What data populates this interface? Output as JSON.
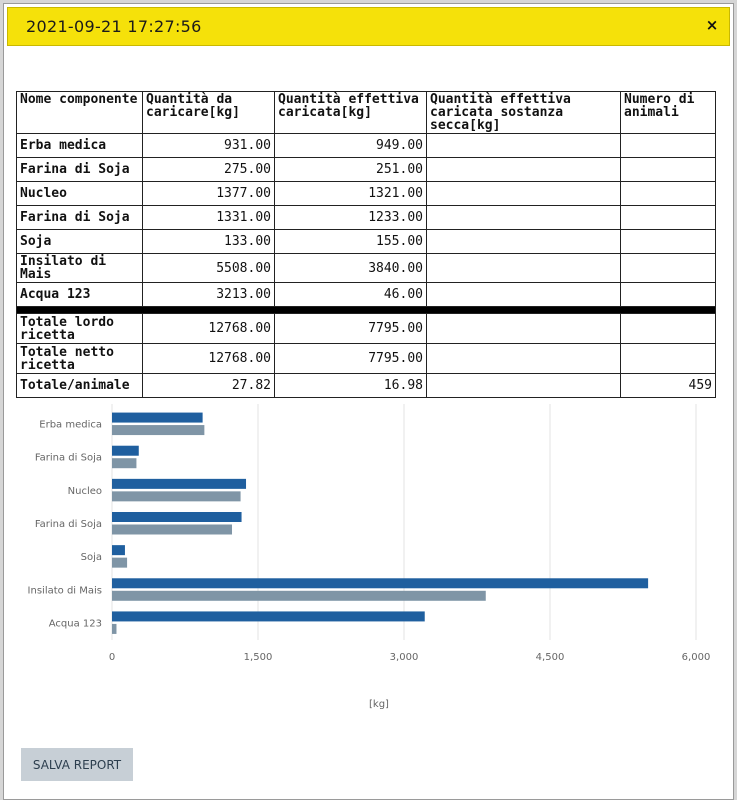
{
  "title": "2021-09-21 17:27:56",
  "close_symbol": "×",
  "table": {
    "headers": [
      "Nome componente",
      "Quantità da caricare[kg]",
      "Quantità effettiva caricata[kg]",
      "Quantità effettiva caricata sostanza secca[kg]",
      "Numero di animali"
    ],
    "rows": [
      [
        "Erba medica",
        "931.00",
        "949.00",
        "",
        ""
      ],
      [
        "Farina di Soja",
        "275.00",
        "251.00",
        "",
        ""
      ],
      [
        "Nucleo",
        "1377.00",
        "1321.00",
        "",
        ""
      ],
      [
        "Farina di Soja",
        "1331.00",
        "1233.00",
        "",
        ""
      ],
      [
        "Soja",
        "133.00",
        "155.00",
        "",
        ""
      ],
      [
        "Insilato di Mais",
        "5508.00",
        "3840.00",
        "",
        ""
      ],
      [
        "Acqua 123",
        "3213.00",
        "46.00",
        "",
        ""
      ]
    ],
    "totals": [
      [
        "Totale lordo ricetta",
        "12768.00",
        "7795.00",
        "",
        ""
      ],
      [
        "Totale netto ricetta",
        "12768.00",
        "7795.00",
        "",
        ""
      ],
      [
        "Totale/animale",
        "27.82",
        "16.98",
        "",
        "459"
      ]
    ]
  },
  "chart_data": {
    "type": "bar",
    "orientation": "horizontal",
    "categories": [
      "Erba medica",
      "Farina di Soja",
      "Nucleo",
      "Farina di Soja",
      "Soja",
      "Insilato di Mais",
      "Acqua 123"
    ],
    "series": [
      {
        "values": [
          931,
          275,
          1377,
          1331,
          133,
          5508,
          3213
        ],
        "color": "#1f5f9f"
      },
      {
        "values": [
          949,
          251,
          1321,
          1233,
          155,
          3840,
          46
        ],
        "color": "#7f95a6"
      }
    ],
    "xlim": [
      0,
      6000
    ],
    "x_ticks": [
      "0",
      "1,500",
      "3,000",
      "4,500",
      "6,000"
    ],
    "x_tick_values": [
      0,
      1500,
      3000,
      4500,
      6000
    ],
    "xlabel": "[kg]",
    "grid": true
  },
  "save_button": "SALVA REPORT"
}
